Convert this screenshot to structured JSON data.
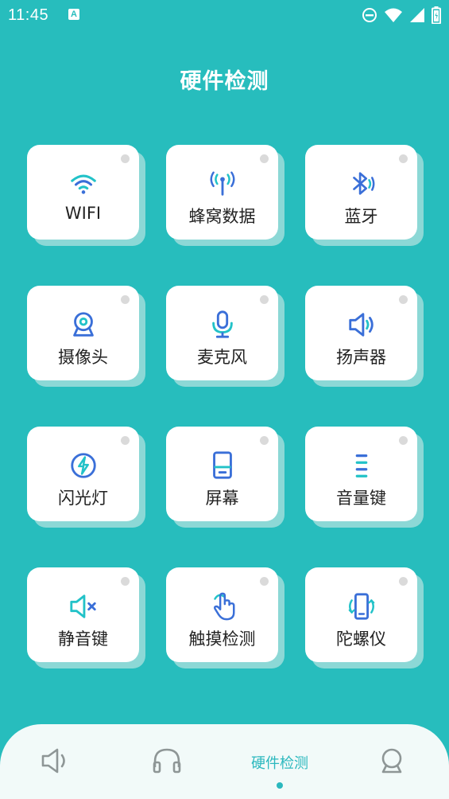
{
  "status_bar": {
    "time": "11:45",
    "notification_letter": "A"
  },
  "header": {
    "title": "硬件检测"
  },
  "colors": {
    "background": "#27BDBD",
    "icon_blue": "#3A6FD8",
    "icon_teal": "#22C2C8",
    "nav_active": "#2BB8BE"
  },
  "cards": [
    {
      "label": "WIFI",
      "icon": "wifi-icon"
    },
    {
      "label": "蜂窝数据",
      "icon": "cellular-signal-icon"
    },
    {
      "label": "蓝牙",
      "icon": "bluetooth-icon"
    },
    {
      "label": "摄像头",
      "icon": "camera-icon"
    },
    {
      "label": "麦克风",
      "icon": "microphone-icon"
    },
    {
      "label": "扬声器",
      "icon": "speaker-icon"
    },
    {
      "label": "闪光灯",
      "icon": "flash-icon"
    },
    {
      "label": "屏幕",
      "icon": "screen-icon"
    },
    {
      "label": "音量键",
      "icon": "volume-keys-icon"
    },
    {
      "label": "静音键",
      "icon": "mute-icon"
    },
    {
      "label": "触摸检测",
      "icon": "touch-icon"
    },
    {
      "label": "陀螺仪",
      "icon": "gyroscope-icon"
    }
  ],
  "bottom_nav": {
    "items": [
      {
        "name": "speaker-icon"
      },
      {
        "name": "headphones-icon"
      },
      {
        "label": "硬件检测",
        "active": true
      },
      {
        "name": "user-icon"
      }
    ]
  }
}
